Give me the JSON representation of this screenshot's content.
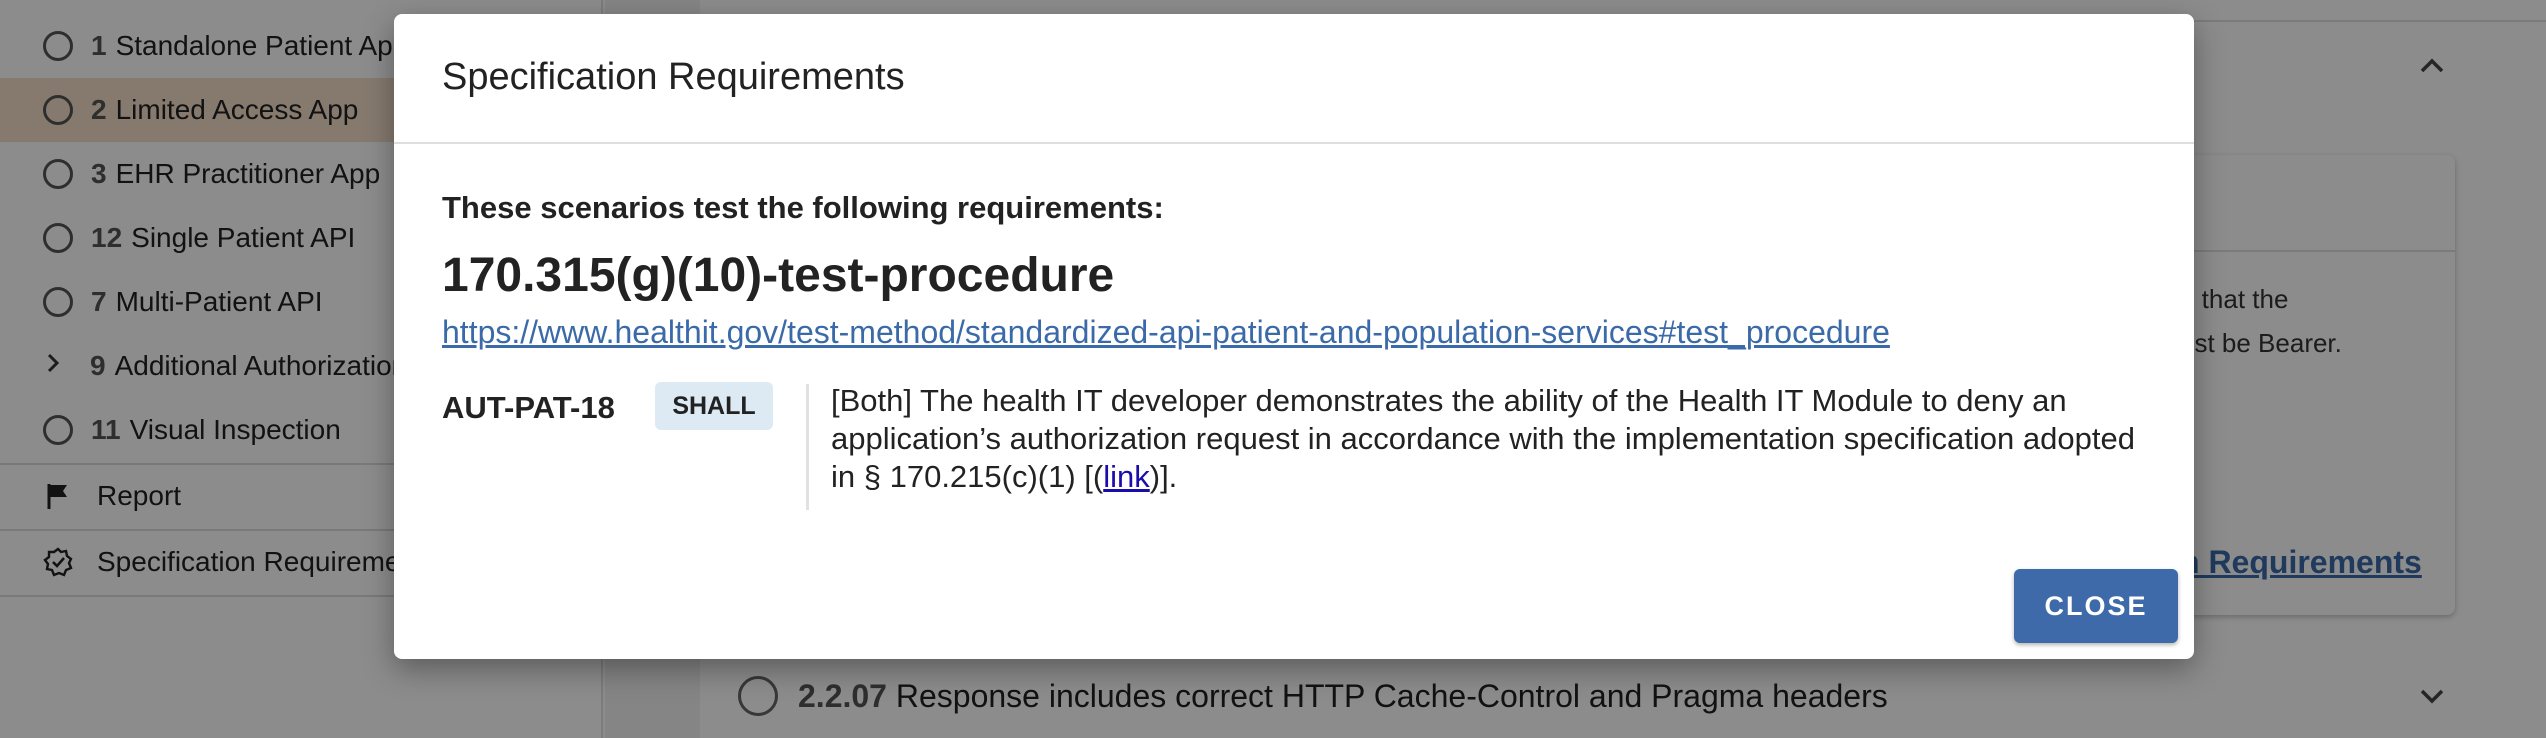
{
  "sidebar": {
    "items": [
      {
        "num": "1",
        "label": "Standalone Patient App",
        "active": false
      },
      {
        "num": "2",
        "label": "Limited Access App",
        "active": true
      },
      {
        "num": "3",
        "label": "EHR Practitioner App",
        "active": false
      },
      {
        "num": "12",
        "label": "Single Patient API",
        "active": false
      },
      {
        "num": "7",
        "label": "Multi-Patient API",
        "active": false
      },
      {
        "num": "9",
        "label": "Additional Authorization Tests",
        "active": false
      },
      {
        "num": "11",
        "label": "Visual Inspection",
        "active": false
      }
    ],
    "report_label": "Report",
    "spec_label": "Specification Requirements"
  },
  "background": {
    "text_line1": "g that the",
    "text_line2": "ust be Bearer.",
    "link_fragment": "n Requirements",
    "bottom_test_num": "2.2.07",
    "bottom_test_label": "Response includes correct HTTP Cache-Control and Pragma headers"
  },
  "modal": {
    "title": "Specification Requirements",
    "intro": "These scenarios test the following requirements:",
    "requirement_set": "170.315(g)(10)-test-procedure",
    "url": "https://www.healthit.gov/test-method/standardized-api-patient-and-population-services#test_procedure",
    "requirements": [
      {
        "id": "AUT-PAT-18",
        "conformance": "SHALL",
        "text_before": "[Both] The health IT developer demonstrates the ability of the Health IT Module to deny an application’s authorization request in accordance with the implementation specification adopted in § 170.215(c)(1) [(",
        "link_text": "link",
        "text_after": ")]."
      }
    ],
    "close_label": "CLOSE"
  },
  "colors": {
    "accent": "#3e6aaa",
    "active_item": "#f4dfca",
    "badge_bg": "#dde9f3",
    "link": "#3a6aa8"
  }
}
